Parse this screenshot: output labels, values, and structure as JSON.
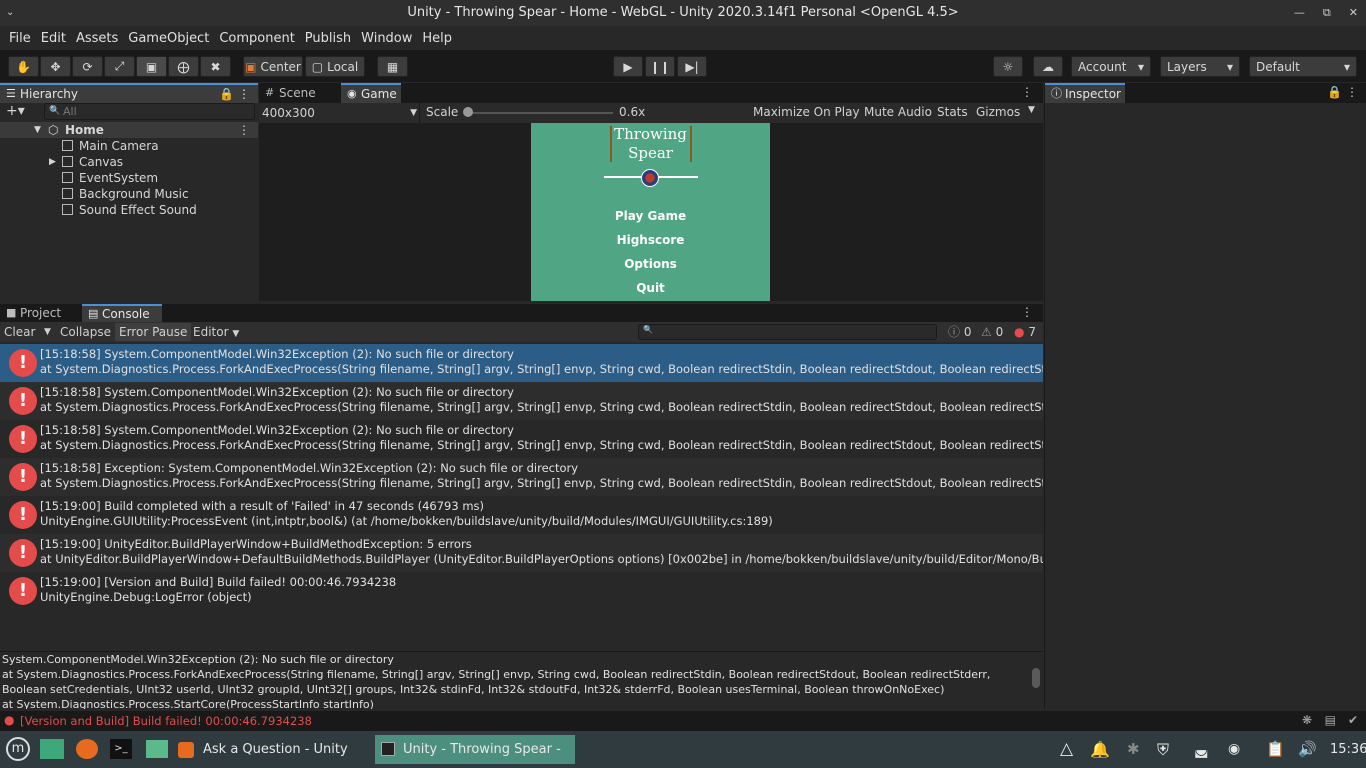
{
  "window": {
    "title": "Unity - Throwing Spear - Home - WebGL - Unity 2020.3.14f1 Personal <OpenGL 4.5>"
  },
  "menu": [
    "File",
    "Edit",
    "Assets",
    "GameObject",
    "Component",
    "Publish",
    "Window",
    "Help"
  ],
  "toolbar": {
    "pivot": "Center",
    "space": "Local",
    "account": "Account",
    "layers": "Layers",
    "layout": "Default"
  },
  "hierarchy": {
    "tab": "Hierarchy",
    "search_placeholder": "All",
    "scene": "Home",
    "items": [
      "Main Camera",
      "Canvas",
      "EventSystem",
      "Background Music",
      "Sound Effect Sound"
    ]
  },
  "scene_tabs": {
    "scene": "Scene",
    "game": "Game"
  },
  "game_bar": {
    "resolution": "400x300",
    "scale_label": "Scale",
    "scale_value": "0.6x",
    "scale_level": 0.0,
    "maximize": "Maximize On Play",
    "mute": "Mute Audio",
    "stats": "Stats",
    "gizmos": "Gizmos"
  },
  "game_view": {
    "title_line1": "Throwing",
    "title_line2": "Spear",
    "menu": [
      "Play Game",
      "Highscore",
      "Options",
      "Quit"
    ],
    "background": "#4fa584"
  },
  "inspector": {
    "tab": "Inspector"
  },
  "console": {
    "tabs": {
      "project": "Project",
      "console": "Console"
    },
    "clear": "Clear",
    "collapse": "Collapse",
    "error_pause": "Error Pause",
    "editor": "Editor",
    "counts": {
      "info": "0",
      "warn": "0",
      "error": "7"
    },
    "logs": [
      {
        "line1": "[15:18:58] System.ComponentModel.Win32Exception (2): No such file or directory",
        "line2": "  at System.Diagnostics.Process.ForkAndExecProcess(String filename, String[] argv, String[] envp, String cwd, Boolean redirectStdin, Boolean redirectStdout, Boolean redirectStder"
      },
      {
        "line1": "[15:18:58] System.ComponentModel.Win32Exception (2): No such file or directory",
        "line2": "  at System.Diagnostics.Process.ForkAndExecProcess(String filename, String[] argv, String[] envp, String cwd, Boolean redirectStdin, Boolean redirectStdout, Boolean redirectStder"
      },
      {
        "line1": "[15:18:58] System.ComponentModel.Win32Exception (2): No such file or directory",
        "line2": "  at System.Diagnostics.Process.ForkAndExecProcess(String filename, String[] argv, String[] envp, String cwd, Boolean redirectStdin, Boolean redirectStdout, Boolean redirectStder"
      },
      {
        "line1": "[15:18:58] Exception: System.ComponentModel.Win32Exception (2): No such file or directory",
        "line2": "  at System.Diagnostics.Process.ForkAndExecProcess(String filename, String[] argv, String[] envp, String cwd, Boolean redirectStdin, Boolean redirectStdout, Boolean redirectStder"
      },
      {
        "line1": "[15:19:00] Build completed with a result of 'Failed' in 47 seconds (46793 ms)",
        "line2": "UnityEngine.GUIUtility:ProcessEvent (int,intptr,bool&) (at /home/bokken/buildslave/unity/build/Modules/IMGUI/GUIUtility.cs:189)"
      },
      {
        "line1": "[15:19:00] UnityEditor.BuildPlayerWindow+BuildMethodException: 5 errors",
        "line2": " at UnityEditor.BuildPlayerWindow+DefaultBuildMethods.BuildPlayer (UnityEditor.BuildPlayerOptions options) [0x002be] in /home/bokken/buildslave/unity/build/Editor/Mono/Build"
      },
      {
        "line1": "[15:19:00] [Version and Build] Build failed! 00:00:46.7934238",
        "line2": "UnityEngine.Debug:LogError (object)"
      }
    ],
    "detail": [
      "System.ComponentModel.Win32Exception (2): No such file or directory",
      "  at System.Diagnostics.Process.ForkAndExecProcess(String filename, String[] argv, String[] envp, String cwd, Boolean redirectStdin, Boolean redirectStdout, Boolean redirectStderr,",
      "Boolean setCredentials, UInt32 userId, UInt32 groupId, UInt32[] groups, Int32& stdinFd, Int32& stdoutFd, Int32& stderrFd, Boolean usesTerminal, Boolean throwOnNoExec)",
      "  at System.Diagnostics.Process.StartCore(ProcessStartInfo startInfo)"
    ]
  },
  "status": {
    "message": "[Version and Build] Build failed! 00:00:46.7934238",
    "color": "#e44c4c"
  },
  "taskbar": {
    "tasks": [
      "Ask a Question - Unity Ans...",
      "Unity - Throwing Spear - H..."
    ],
    "clock": "15:36"
  }
}
